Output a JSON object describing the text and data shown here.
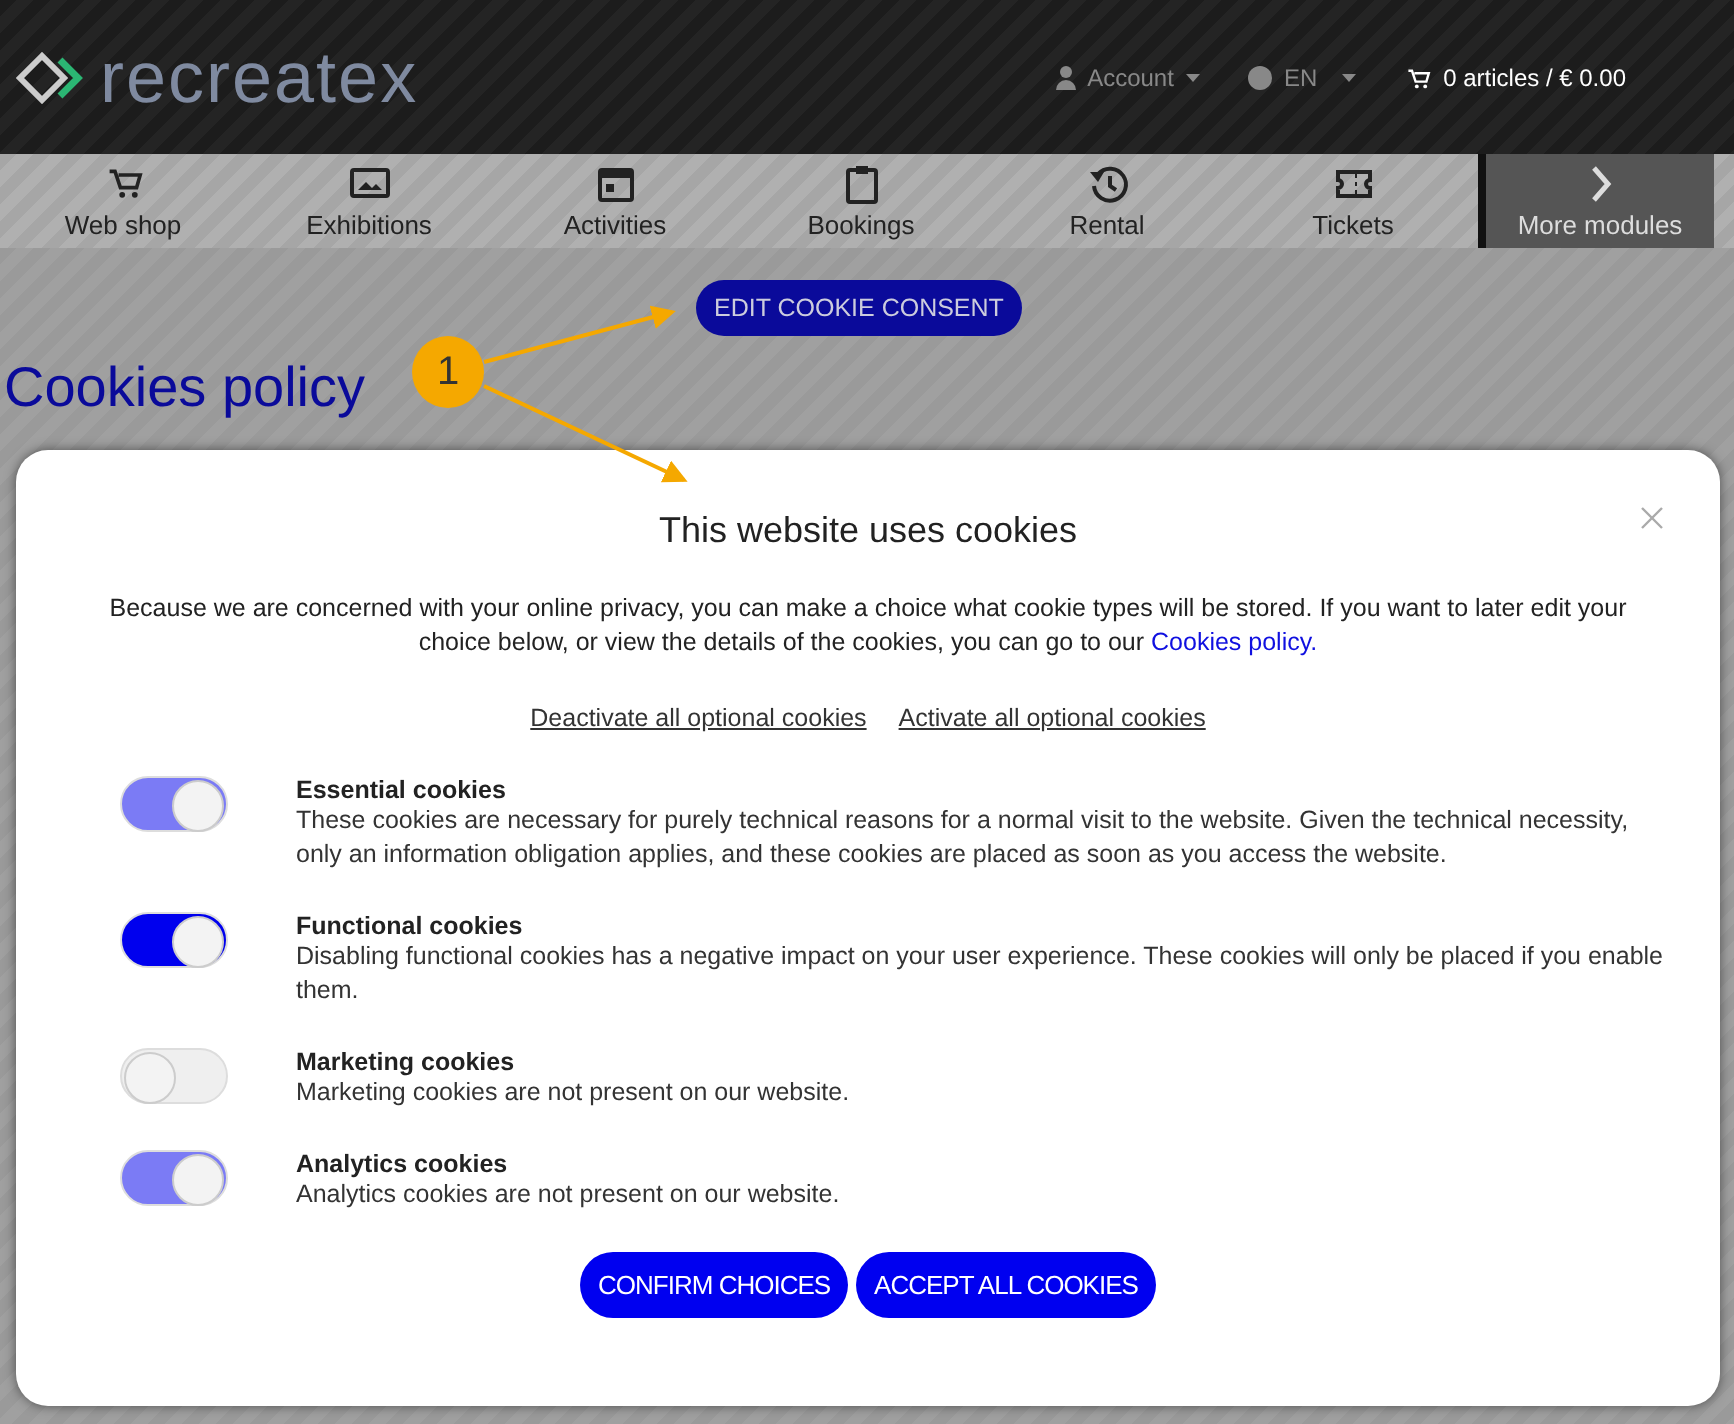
{
  "header": {
    "logo": "recreatex",
    "account": "Account",
    "language": "EN",
    "cart": "0 articles / € 0.00"
  },
  "nav": [
    {
      "label": "Web shop",
      "kind": "cart"
    },
    {
      "label": "Exhibitions",
      "kind": "image"
    },
    {
      "label": "Activities",
      "kind": "calendar"
    },
    {
      "label": "Bookings",
      "kind": "clipboard"
    },
    {
      "label": "Rental",
      "kind": "history"
    },
    {
      "label": "Tickets",
      "kind": "ticket"
    },
    {
      "label": "More modules",
      "kind": "more"
    }
  ],
  "edit_button": "EDIT COOKIE CONSENT",
  "page_title": "Cookies policy",
  "annotation": {
    "number": "1"
  },
  "dialog": {
    "title": "This website uses cookies",
    "intro": "Because we are concerned with your online privacy, you can make a choice what cookie types will be stored. If you want to later edit your choice below, or view the details of the cookies, you can go to our ",
    "intro_link": "Cookies policy.",
    "links": [
      "Deactivate all optional cookies",
      "Activate all optional cookies"
    ],
    "options": [
      {
        "title": "Essential cookies",
        "text": "These cookies are necessary for purely technical reasons for a normal visit to the website. Given the technical necessity, only an information obligation applies, and these cookies are placed as soon as you access the website.",
        "on": true,
        "disabled": true
      },
      {
        "title": "Functional cookies",
        "text": "Disabling functional cookies has a negative impact on your user experience. These cookies will only be placed if you enable them.",
        "on": true,
        "disabled": false
      },
      {
        "title": "Marketing cookies",
        "text": "Marketing cookies are not present on our website.",
        "on": false,
        "disabled": true
      },
      {
        "title": "Analytics cookies",
        "text": "Analytics cookies are not present on our website.",
        "on": true,
        "disabled": true
      }
    ],
    "buttons": [
      "CONFIRM CHOICES",
      "ACCEPT ALL COOKIES"
    ]
  }
}
